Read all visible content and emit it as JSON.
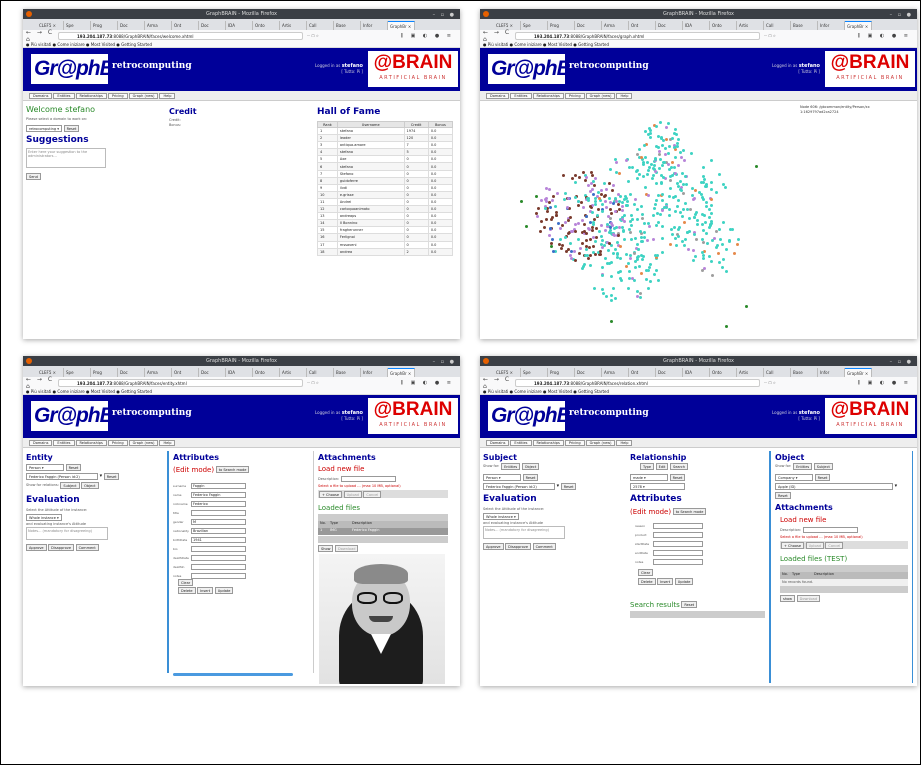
{
  "browser": {
    "window_title": "GraphBRAIN - Mozilla Firefox",
    "tabs": [
      "CLEF5 ×",
      "Spe",
      "Prog",
      "Doc",
      "Arma",
      "Ont",
      "Doc",
      "IDA",
      "Onto",
      "Artis",
      "Call",
      "Base",
      "Infor",
      "GraphBr ×"
    ],
    "url_prefix": "193.204.187.73",
    "url_suffixes": {
      "home": ":8088/GraphBRAIN/faces/welcome.xhtml",
      "graph": ":8088/GraphBRAIN/faces/graph.xhtml",
      "entity": ":8088/GraphBRAIN/faces/entity.xhtml",
      "relation": ":8088/GraphBRAIN/faces/relation.xhtml"
    },
    "nav_icons": "← → C ⌂",
    "url_tools": "··· ☐ ☆",
    "right_tools": "⫼ ▣ ◐ ● ≡",
    "bookmarks": "● Più visitati  ● Come iniziare  ● Most Visited  ● Getting Started"
  },
  "site": {
    "logo_a": "Gr@ph",
    "logo_b": "BRAIN",
    "name": "retrocomputing",
    "login_label": "Logged in as",
    "user": "stefano",
    "logout": "[ Tutto: Pi ]",
    "brand": "@BRAIN",
    "brand_sub": "ARTIFICIAL BRAIN",
    "menu": [
      "Domains",
      "Entities",
      "Relationships",
      "Pricing",
      "Graph (new)",
      "Help"
    ]
  },
  "home": {
    "welcome": "Welcome stefano",
    "domain_prompt": "Please select a domain to work on:",
    "domain_value": "retrocomputing",
    "reset": "Reset",
    "suggestions_title": "Suggestions",
    "suggestion_placeholder": "Enter here your suggestion to the administrators...",
    "send": "Send",
    "credit_title": "Credit",
    "credit_lines": [
      "Credit:",
      "Bonus:"
    ],
    "hof_title": "Hall of Fame",
    "hof_headers": [
      "Rank",
      "Username",
      "Credit",
      "Bonus"
    ],
    "hof_rows": [
      [
        "1",
        "stefano",
        "1974",
        "0.0"
      ],
      [
        "2",
        "leader",
        "120",
        "0.0"
      ],
      [
        "3",
        "antiqua.amore",
        "7",
        "0.0"
      ],
      [
        "4",
        "stefano",
        "5",
        "0.0"
      ],
      [
        "5",
        "Axe",
        "0",
        "0.0"
      ],
      [
        "6",
        "stefano",
        "0",
        "0.0"
      ],
      [
        "7",
        "Stefano",
        "0",
        "0.0"
      ],
      [
        "8",
        "guidoferre",
        "0",
        "0.0"
      ],
      [
        "9",
        "ilvdi",
        "0",
        "0.0"
      ],
      [
        "10",
        "e.grisse",
        "0",
        "0.0"
      ],
      [
        "11",
        "Andrei",
        "0",
        "0.0"
      ],
      [
        "12",
        "carloquoanimato",
        "0",
        "0.0"
      ],
      [
        "13",
        "andreaps",
        "0",
        "0.0"
      ],
      [
        "14",
        "Il Bonnino",
        "0",
        "0.0"
      ],
      [
        "15",
        "fragherunner",
        "0",
        "0.0"
      ],
      [
        "16",
        "Ferlignoi",
        "0",
        "0.0"
      ],
      [
        "17",
        "mssaveni",
        "0",
        "0.0"
      ],
      [
        "18",
        "andrea",
        "2",
        "0.0"
      ]
    ]
  },
  "graph": {
    "node_caption": "Node 606: /gbcommon/entity/Person/xx",
    "node_id": "1:1629797ad2ca2724",
    "colors": [
      "#3fd3c3",
      "#7a3b2e",
      "#b884d9",
      "#3b6ec8",
      "#9e9e9e",
      "#e6894a",
      "#2a8a2a",
      "#5f3e9a",
      "#c0d8f0"
    ]
  },
  "entity": {
    "title": "Entity",
    "type_value": "Person",
    "reset": "Reset",
    "instance_value": "Federico Faggin (Person id:2)",
    "reset2": "Reset",
    "show_label": "Show for relations:",
    "subject": "Subject",
    "object": "Object",
    "eval_title": "Evaluation",
    "eval_prompt": "Select the Attitude of the instance:",
    "eval_value": "Whole instance",
    "eval_sub": "and evaluating instance's Attitude",
    "eval_note": "Notes... (mandatory for disagreeing)",
    "approve": "Approve",
    "disapprove": "Disapprove",
    "comment": "Comment",
    "attr_title": "Attributes",
    "edit_mode": "(Edit mode)",
    "to_search": "to Search mode",
    "fields": [
      [
        "surname",
        "Faggin"
      ],
      [
        "name",
        "Federico Faggin"
      ],
      [
        "nickname",
        "Federico"
      ],
      [
        "title",
        ""
      ],
      [
        "gender",
        "M"
      ],
      [
        "nationality",
        "Brazilian"
      ],
      [
        "birthDate",
        "1941"
      ],
      [
        "bio",
        ""
      ],
      [
        "deathDate",
        ""
      ],
      [
        "deathIn",
        ""
      ],
      [
        "notes",
        ""
      ]
    ],
    "clear": "Clear",
    "delete": "Delete",
    "insert": "Insert",
    "update": "Update",
    "att_title": "Attachments",
    "load_new": "Load new file",
    "desc_label": "Description:",
    "att_note": "Select a file to upload ... (max 10 MB, optional)",
    "choose": "+ Choose",
    "upload": "Upload",
    "cancel": "Cancel",
    "loaded": "Loaded files",
    "lf_headers": [
      "No.",
      "Type",
      "Description"
    ],
    "lf_row": [
      "1",
      "IMG",
      "Federico Faggin"
    ],
    "show": "Show",
    "download": "Download"
  },
  "relation": {
    "subject_title": "Subject",
    "show_for": "Show for:",
    "entities": "Entities",
    "object": "Object",
    "type_value": "Person",
    "reset": "Reset",
    "inst_value": "Federico Faggin (Person id:2)",
    "eval_title": "Evaluation",
    "eval_prompt": "Select the Attitude of the instance:",
    "eval_value": "Whole instance",
    "eval_sub": "and evaluating instance's Attitude",
    "eval_note": "Notes... (mandatory for disagreeing)",
    "approve": "Approve",
    "disapprove": "Disapprove",
    "comment": "Comment",
    "rel_title": "Relationship",
    "rel_btns": [
      "Type",
      "Edit",
      "Search"
    ],
    "rel_value": "made",
    "rel_inst": "2578",
    "attr_title": "Attributes",
    "edit_mode": "(Edit mode)",
    "to_search": "to Search mode",
    "fields": [
      "reason",
      "product",
      "startDate",
      "endDate",
      "notes"
    ],
    "clear": "Clear",
    "delete": "Delete",
    "insert": "Insert",
    "update": "Update",
    "search_results": "Search results",
    "reset2": "Reset",
    "obj_title": "Object",
    "show_for2": "Show for:",
    "entities2": "Entities",
    "subject2": "Subject",
    "obj_type": "Company",
    "reset3": "Reset",
    "obj_inst": "Apple (ID)",
    "reset4": "Reset",
    "att_title": "Attachments",
    "load_new": "Load new file",
    "desc_label": "Description:",
    "att_note": "Select a file to upload ... (max 10 MB, optional)",
    "choose": "+ Choose",
    "upload": "Upload",
    "cancel": "Cancel",
    "loaded": "Loaded files (TEST)",
    "lf_headers": [
      "No.",
      "Type",
      "Description"
    ],
    "no_records": "No records found.",
    "show": "show",
    "download": "Download"
  }
}
